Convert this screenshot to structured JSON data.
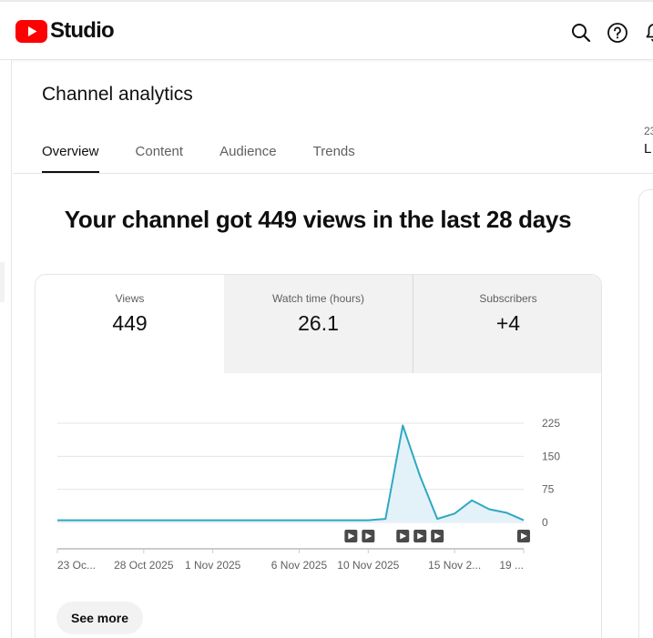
{
  "app": {
    "name": "Studio",
    "brand_color": "#ff0000"
  },
  "header_icons": [
    "search-icon",
    "help-icon",
    "notifications-icon"
  ],
  "page": {
    "title": "Channel analytics",
    "tabs": [
      {
        "label": "Overview",
        "active": true
      },
      {
        "label": "Content",
        "active": false
      },
      {
        "label": "Audience",
        "active": false
      },
      {
        "label": "Trends",
        "active": false
      }
    ],
    "side_date": "23",
    "side_range": "L"
  },
  "headline": "Your channel got 449 views in the last 28 days",
  "metrics": [
    {
      "label": "Views",
      "value": "449",
      "selected": true
    },
    {
      "label": "Watch time (hours)",
      "value": "26.1",
      "selected": false
    },
    {
      "label": "Subscribers",
      "value": "+4",
      "selected": false
    }
  ],
  "chart_data": {
    "type": "area",
    "series": [
      {
        "values": [
          5,
          5,
          5,
          5,
          5,
          5,
          5,
          5,
          5,
          5,
          5,
          5,
          5,
          5,
          5,
          5,
          5,
          5,
          5,
          8,
          220,
          105,
          8,
          20,
          50,
          30,
          22,
          5
        ]
      }
    ],
    "y_ticks": [
      225,
      150,
      75,
      0
    ],
    "ylim": [
      0,
      225
    ],
    "x_labels": [
      {
        "label": "23 Oc...",
        "index": 0
      },
      {
        "label": "28 Oct 2025",
        "index": 5
      },
      {
        "label": "1 Nov 2025",
        "index": 9
      },
      {
        "label": "6 Nov 2025",
        "index": 14
      },
      {
        "label": "10 Nov 2025",
        "index": 18
      },
      {
        "label": "15 Nov 2...",
        "index": 23
      },
      {
        "label": "19 ...",
        "index": 27
      }
    ],
    "video_markers": [
      17,
      18,
      20,
      21,
      22,
      27
    ],
    "line_color": "#2fa8c2",
    "fill_color": "#e3f2f8",
    "grid": true
  },
  "see_more_label": "See more"
}
